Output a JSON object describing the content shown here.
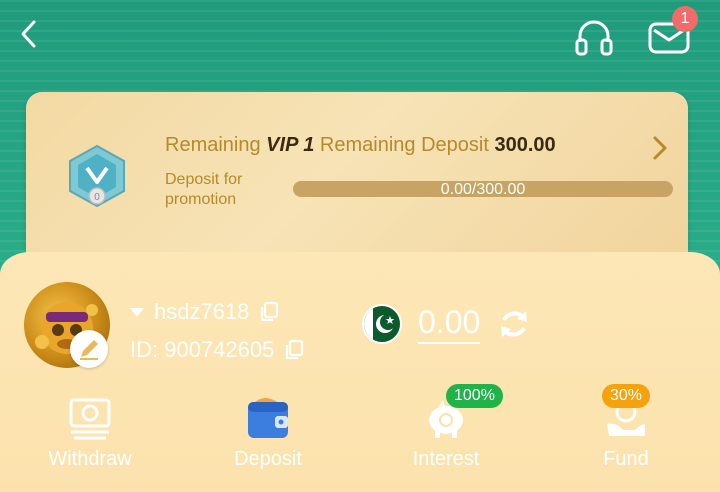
{
  "header": {
    "mail_badge": "1"
  },
  "vip": {
    "remaining_label": "Remaining",
    "vip_name": "VIP 1",
    "remaining_deposit_label": "Remaining Deposit",
    "remaining_deposit_value": "300.00",
    "sub_label": "Deposit for promotion",
    "progress_text": "0.00/300.00",
    "progress_fraction": 0,
    "badge_level": "0"
  },
  "user": {
    "username": "hsdz7618",
    "id_text": "ID: 900742605",
    "balance": "0.00"
  },
  "actions": [
    {
      "label": "Withdraw",
      "icon": "cash-icon"
    },
    {
      "label": "Deposit",
      "icon": "wallet-icon"
    },
    {
      "label": "Interest",
      "icon": "piggy-bank-icon",
      "badge": "100%"
    },
    {
      "label": "Fund",
      "icon": "hand-coin-icon",
      "badge": "30%"
    }
  ],
  "colors": {
    "brand_green": "#2bae8a",
    "gold_text": "#b58a2b",
    "badge_red": "#f26b6b",
    "pill_green": "#1fb34a",
    "pill_orange": "#f5a20e"
  }
}
